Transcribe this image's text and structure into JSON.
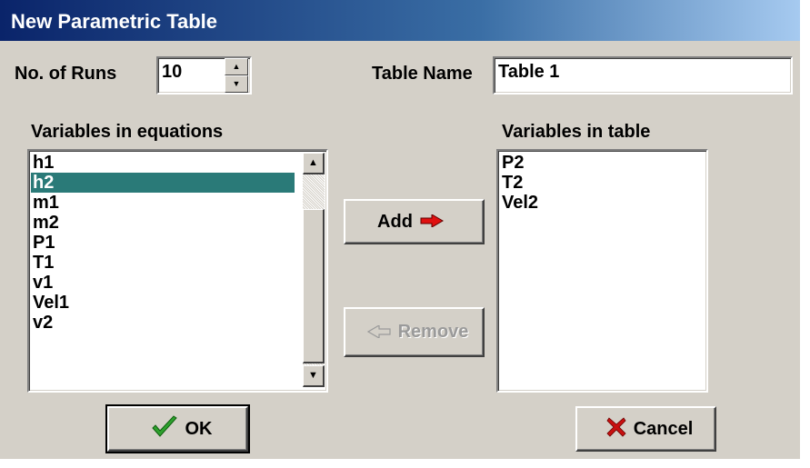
{
  "window": {
    "title": "New Parametric Table"
  },
  "runs": {
    "label": "No. of Runs",
    "value": "10",
    "spin_up": "▲",
    "spin_down": "▼"
  },
  "table_name": {
    "label": "Table Name",
    "value": "Table 1"
  },
  "equations": {
    "label": "Variables in equations",
    "items": [
      "h1",
      "h2",
      "m1",
      "m2",
      "P1",
      "T1",
      "v1",
      "Vel1",
      "v2"
    ],
    "selected": "h2",
    "scroll_up": "▲",
    "scroll_down": "▼"
  },
  "table_vars": {
    "label": "Variables in table",
    "items": [
      "P2",
      "T2",
      "Vel2"
    ]
  },
  "buttons": {
    "add": "Add",
    "remove": "Remove",
    "ok": "OK",
    "cancel": "Cancel"
  },
  "colors": {
    "selection": "#2a7a78",
    "title_gradient_start": "#0a246a",
    "checkmark": "#2ea12e",
    "cancel_x": "#c81010",
    "add_arrow": "#e01010"
  },
  "icons": {
    "add": "arrow-right-icon",
    "remove": "arrow-left-icon",
    "ok": "checkmark-icon",
    "cancel": "x-icon"
  }
}
